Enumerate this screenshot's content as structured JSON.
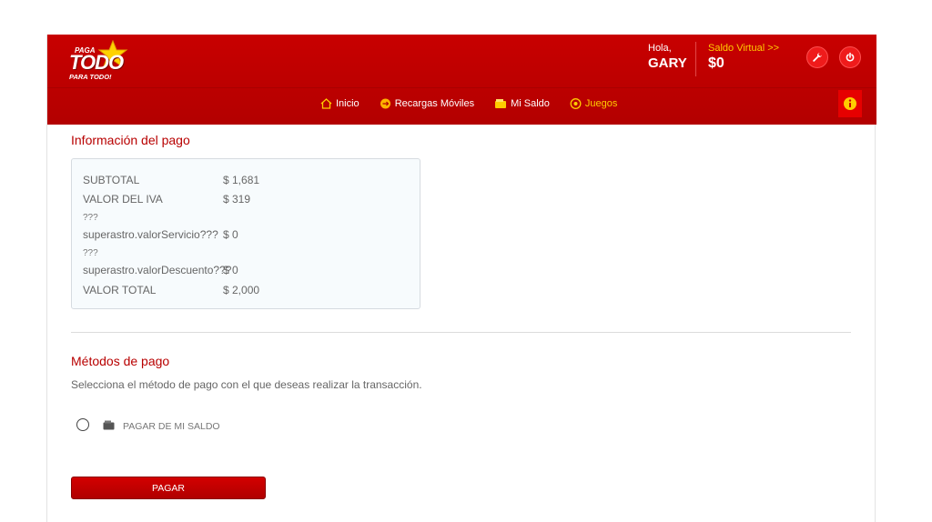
{
  "brand": {
    "line1": "PAGA",
    "line2": "TODO",
    "line3": "PARA TODO!"
  },
  "header": {
    "greeting": "Hola,",
    "username": "GARY",
    "saldo_label": "Saldo Virtual >>",
    "saldo_amount": "$0"
  },
  "nav": {
    "items": [
      {
        "label": "Inicio",
        "icon": "home-icon"
      },
      {
        "label": "Recargas Móviles",
        "icon": "recargas-icon"
      },
      {
        "label": "Mi Saldo",
        "icon": "wallet-icon"
      },
      {
        "label": "Juegos",
        "icon": "juegos-icon"
      }
    ]
  },
  "payment_info": {
    "title": "Información del pago",
    "rows": {
      "subtotal": {
        "label": "SUBTOTAL",
        "value": "$ 1,681"
      },
      "iva": {
        "label": "VALOR DEL IVA",
        "value": "$ 319"
      },
      "servicio": {
        "prefix": "???",
        "label": "superastro.valorServicio???",
        "value": "$ 0"
      },
      "descuento": {
        "prefix": "???",
        "label": "superastro.valorDescuento???",
        "value": "$ 0"
      },
      "total": {
        "label": "VALOR TOTAL",
        "value": "$ 2,000"
      }
    }
  },
  "methods": {
    "title": "Métodos de pago",
    "description": "Selecciona el método de pago con el que deseas realizar la transacción.",
    "option_label": "PAGAR DE MI SALDO"
  },
  "actions": {
    "pay_label": "PAGAR"
  },
  "colors": {
    "brand_red": "#c80000",
    "accent_yellow": "#ffcc00",
    "title_red": "#b80000"
  }
}
